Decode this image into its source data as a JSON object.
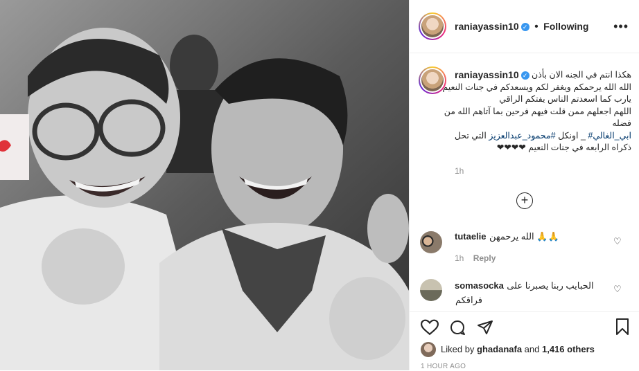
{
  "post": {
    "photo_alt": "Black and white photo of two laughing men",
    "username": "raniayassin10",
    "follow_status": "Following",
    "menu_icon": "more-options-icon"
  },
  "caption": {
    "line1": "هكذا انتم في الجنه الان بأذن",
    "line2": "الله الله يرحمكم ويغفر لكم ويسعدكم في جنات النعيم",
    "line3": "يارب كما اسعدتم الناس يفتكم الراقي",
    "line4": "اللهم اجعلهم ممن قلت فيهم فرحين بما آتاهم الله من",
    "line5": "فضله",
    "line6_hash1": "#محمود_عبدالعزيز",
    "line6_text": "اونكل",
    "line6_after": " التي تحل",
    "line7_hash2": "ابي_الغالي#",
    "line7_text": " _",
    "line8": "ذكراه الرابعه في جنات النعيم ❤❤❤❤",
    "time": "1h"
  },
  "comments": [
    {
      "user": "tutaelie",
      "text": "الله يرحمهن 🙏🙏",
      "time": "1h",
      "reply": "Reply"
    },
    {
      "user": "somasocka",
      "text_line1": "الحبايب ربنا يصبرنا على",
      "text_line2": "فراقكم"
    }
  ],
  "footer": {
    "liked_prefix": "Liked by ",
    "liked_user": "ghadanafa",
    "liked_mid": " and ",
    "liked_count": "1,416 others",
    "ago": "1 HOUR AGO"
  }
}
